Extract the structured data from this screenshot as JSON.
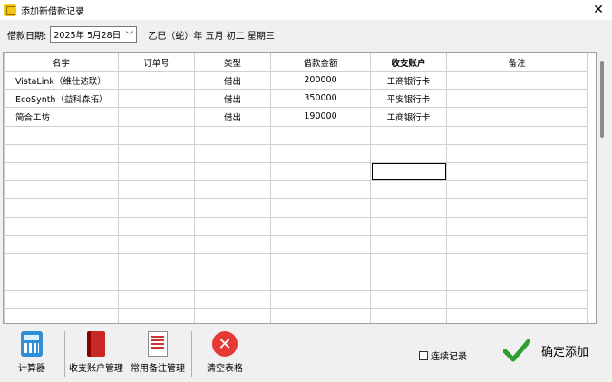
{
  "window": {
    "title": "添加新借款记录",
    "close_glyph": "✕"
  },
  "date": {
    "label": "借款日期:",
    "value": "2025年  5月28日",
    "lunar": "乙巳（蛇）年  五月  初二  星期三"
  },
  "table": {
    "columns": [
      {
        "label": "名字",
        "bold": false
      },
      {
        "label": "订单号",
        "bold": false
      },
      {
        "label": "类型",
        "bold": false
      },
      {
        "label": "借款金额",
        "bold": false
      },
      {
        "label": "收支账户",
        "bold": true
      },
      {
        "label": "备注",
        "bold": false
      }
    ],
    "rows": [
      [
        "VistaLink（维仕达联）",
        "",
        "借出",
        "200000",
        "工商银行卡",
        ""
      ],
      [
        "EcoSynth（益科森拓）",
        "",
        "借出",
        "350000",
        "平安银行卡",
        ""
      ],
      [
        "简合工坊",
        "",
        "借出",
        "190000",
        "工商银行卡",
        ""
      ]
    ],
    "empty_rows": 12,
    "selected_cell": {
      "row": 5,
      "col": 4
    }
  },
  "toolbar": {
    "calculator": {
      "label": "计算器",
      "icon": "calculator-icon"
    },
    "accounts": {
      "label": "收支账户管理",
      "icon": "red-book-icon"
    },
    "notes": {
      "label": "常用备注管理",
      "icon": "notes-doc-icon"
    },
    "clear": {
      "label": "清空表格",
      "icon": "clear-x-icon"
    },
    "continuous": {
      "label": "连续记录",
      "checked": false
    },
    "confirm": {
      "label": "确定添加",
      "icon": "green-check-icon"
    }
  },
  "colors": {
    "accent_check": "#2e9e2e",
    "clear_red": "#e53935",
    "calc_blue": "#2e8fd8"
  }
}
